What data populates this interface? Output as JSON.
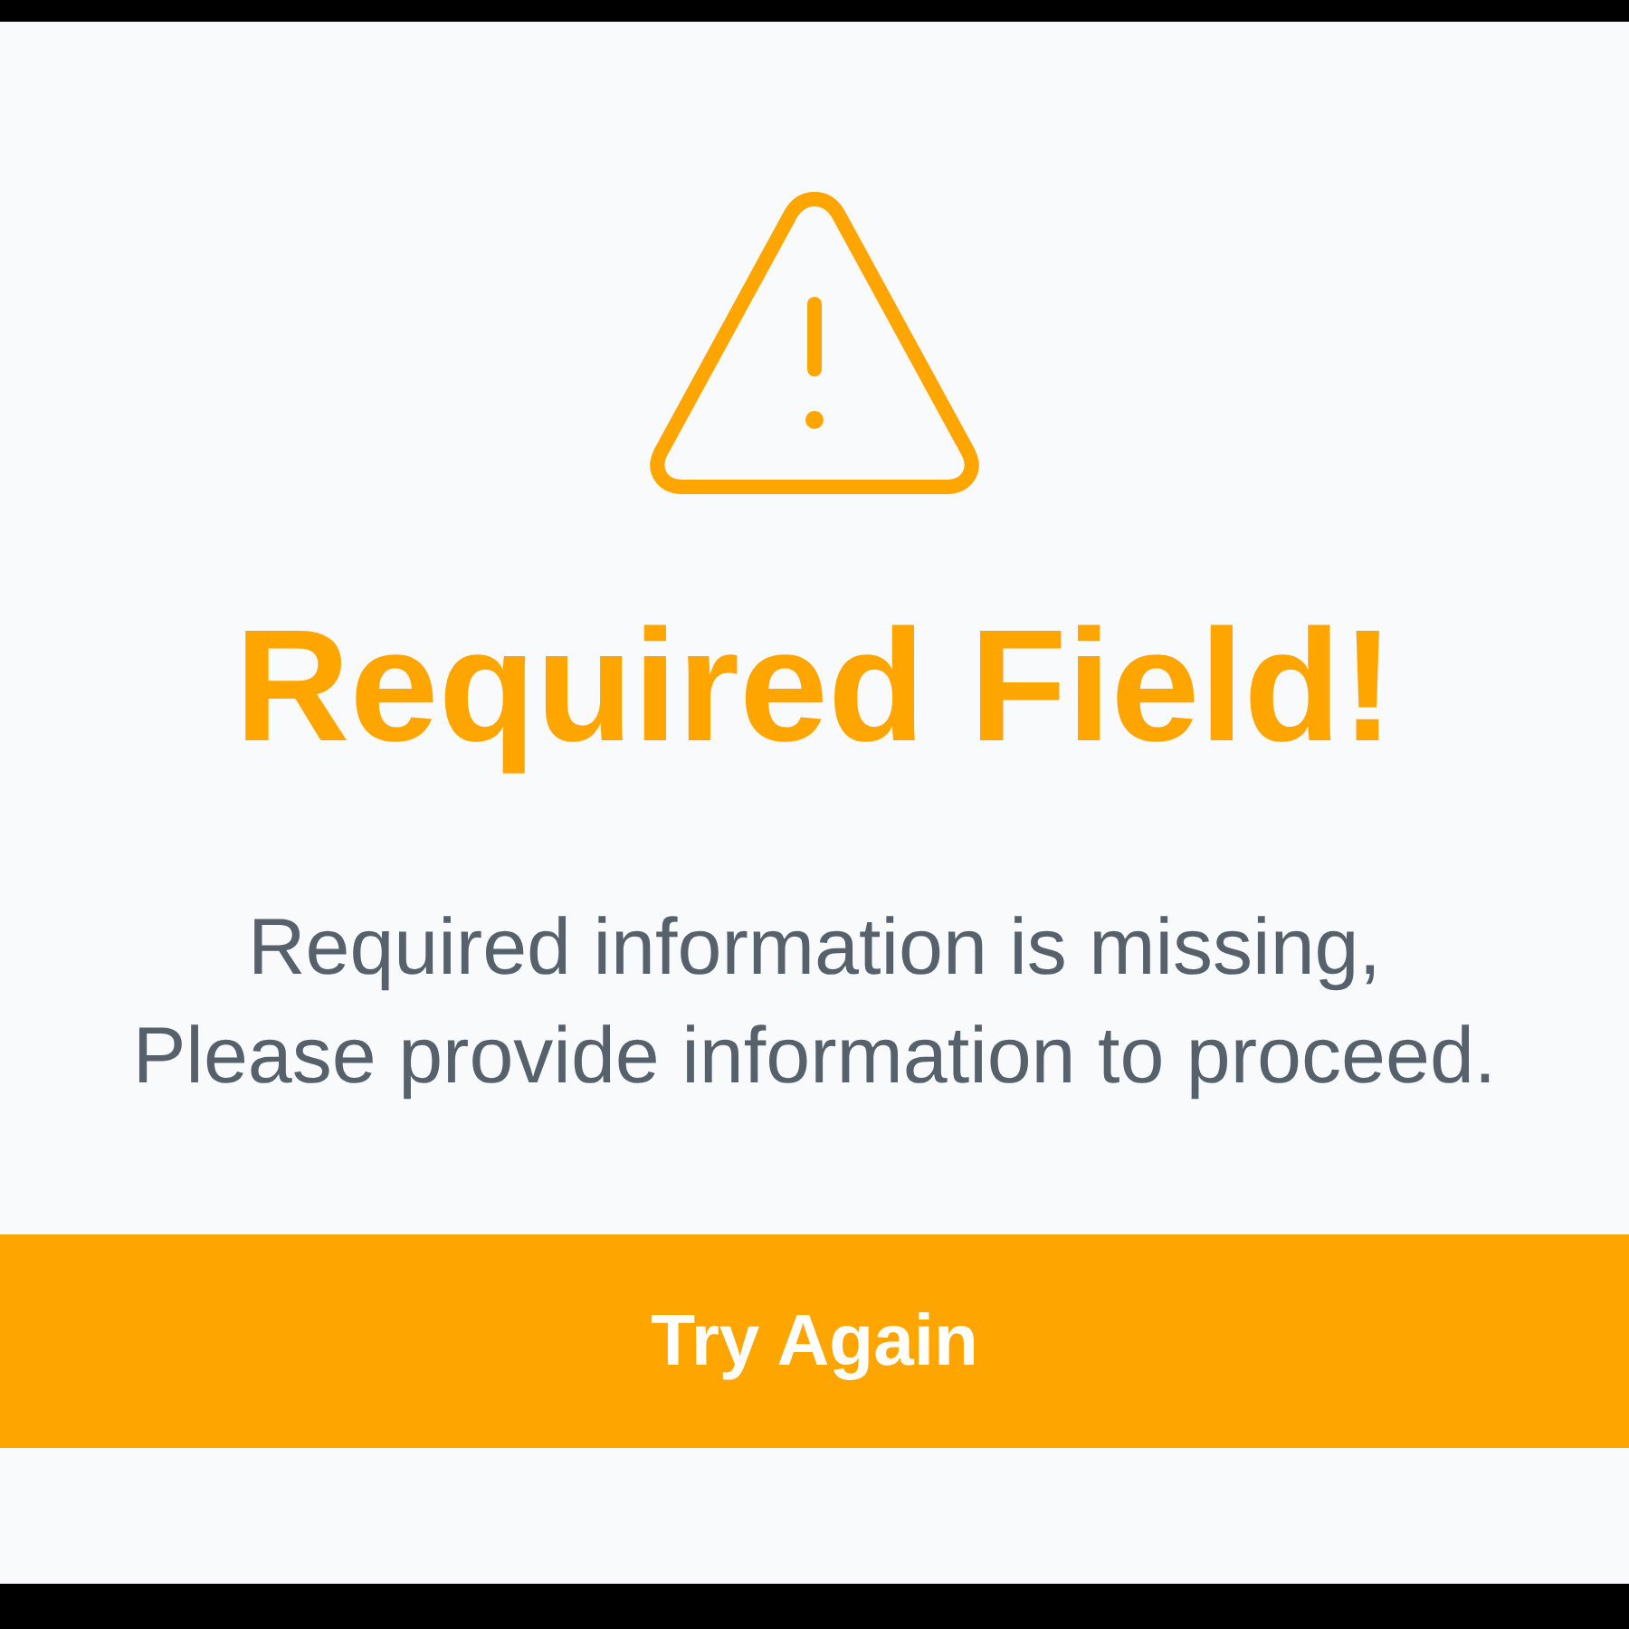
{
  "alert": {
    "title": "Required Field!",
    "message": [
      "Required information is missing,",
      "Please provide information to proceed."
    ],
    "button": "Try Again"
  }
}
